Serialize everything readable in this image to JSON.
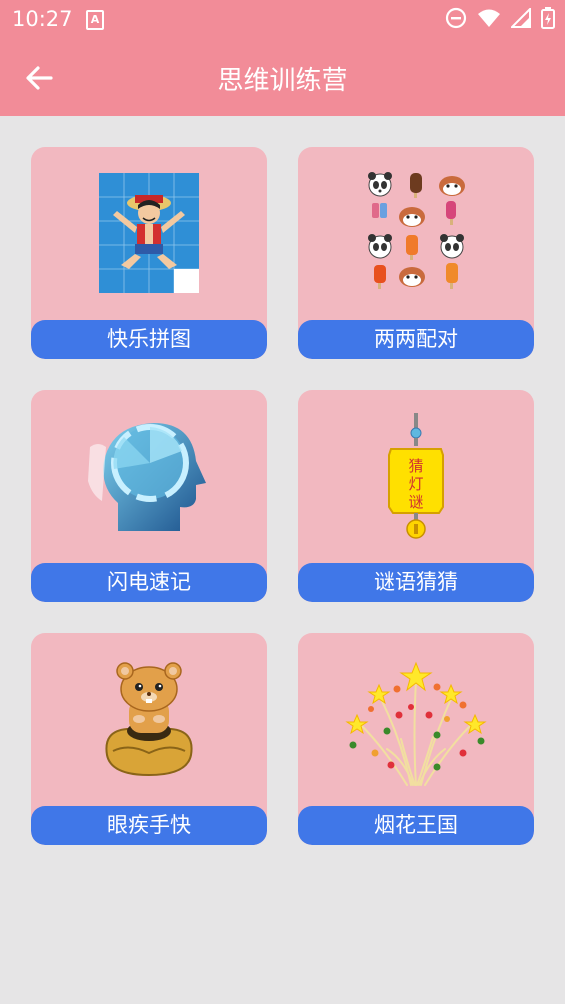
{
  "status_bar": {
    "time": "10:27",
    "notification_icon": "A"
  },
  "header": {
    "title": "思维训练营",
    "back_icon": "arrow-left-icon"
  },
  "games": [
    {
      "label": "快乐拼图",
      "icon": "puzzle-image"
    },
    {
      "label": "两两配对",
      "icon": "pair-match-image"
    },
    {
      "label": "闪电速记",
      "icon": "brain-head-image"
    },
    {
      "label": "谜语猜猜",
      "icon": "lantern-riddle-image",
      "lantern_text": "猜灯谜"
    },
    {
      "label": "眼疾手快",
      "icon": "hamster-image"
    },
    {
      "label": "烟花王国",
      "icon": "fireworks-image"
    }
  ],
  "colors": {
    "header": "#f28c98",
    "card": "#f2b8c0",
    "button": "#4077e8",
    "background": "#e6e5e6"
  }
}
